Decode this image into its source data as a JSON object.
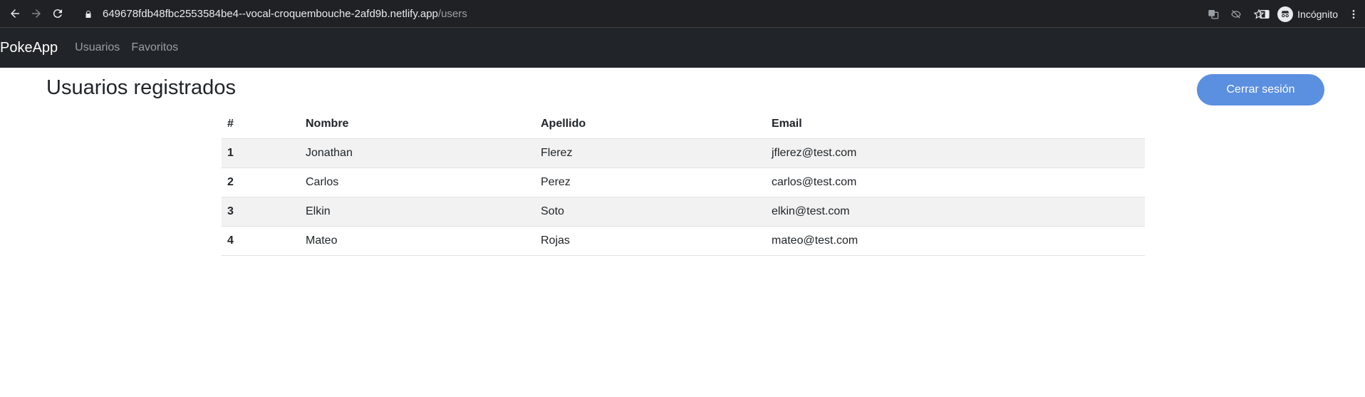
{
  "browser": {
    "url_host": "649678fdb48fbc2553584be4--vocal-croquembouche-2afd9b.netlify.app",
    "url_path": "/users",
    "profile_label": "Incógnito",
    "icons": [
      "back-icon",
      "forward-icon",
      "reload-icon",
      "lock-icon",
      "translate-icon",
      "eye-off-icon",
      "star-icon",
      "side-panel-icon",
      "incognito-icon",
      "menu-icon"
    ]
  },
  "navbar": {
    "brand": "PokeApp",
    "links": [
      "Usuarios",
      "Favoritos"
    ]
  },
  "main": {
    "title": "Usuarios registrados",
    "logout_label": "Cerrar sesión",
    "accent_color": "#5b8fe0"
  },
  "table": {
    "headers": [
      "#",
      "Nombre",
      "Apellido",
      "Email"
    ],
    "rows": [
      [
        "1",
        "Jonathan",
        "Flerez",
        "jflerez@test.com"
      ],
      [
        "2",
        "Carlos",
        "Perez",
        "carlos@test.com"
      ],
      [
        "3",
        "Elkin",
        "Soto",
        "elkin@test.com"
      ],
      [
        "4",
        "Mateo",
        "Rojas",
        "mateo@test.com"
      ]
    ]
  }
}
